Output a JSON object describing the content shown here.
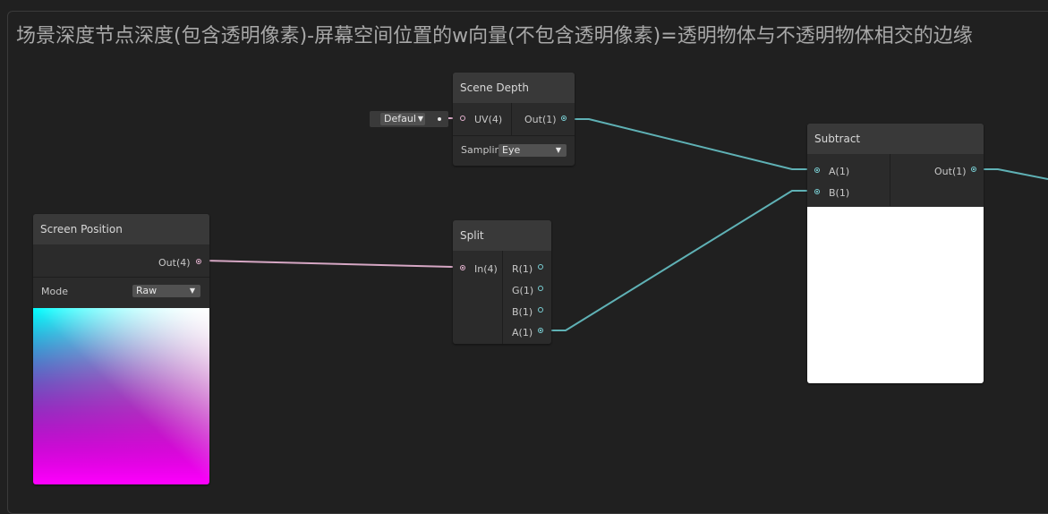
{
  "title": "场景深度节点深度(包含透明像素)-屏幕空间位置的w向量(不包含透明像素)=透明物体与不透明物体相交的边缘",
  "nodes": {
    "scene_depth": {
      "header": "Scene Depth",
      "input_uv": "UV(4)",
      "output": "Out(1)",
      "sampling_label": "Samplin",
      "sampling_value": "Eye",
      "uv_default": "Defaul"
    },
    "screen_position": {
      "header": "Screen Position",
      "output": "Out(4)",
      "mode_label": "Mode",
      "mode_value": "Raw"
    },
    "split": {
      "header": "Split",
      "input": "In(4)",
      "outputs": [
        "R(1)",
        "G(1)",
        "B(1)",
        "A(1)"
      ]
    },
    "subtract": {
      "header": "Subtract",
      "inputs": [
        "A(1)",
        "B(1)"
      ],
      "output": "Out(1)"
    }
  },
  "colors": {
    "float_wire": "#5fb1b5",
    "vector4_wire": "#d6a7c4"
  },
  "icons": [
    "dropdown-arrow-icon",
    "port-dot-icon"
  ]
}
